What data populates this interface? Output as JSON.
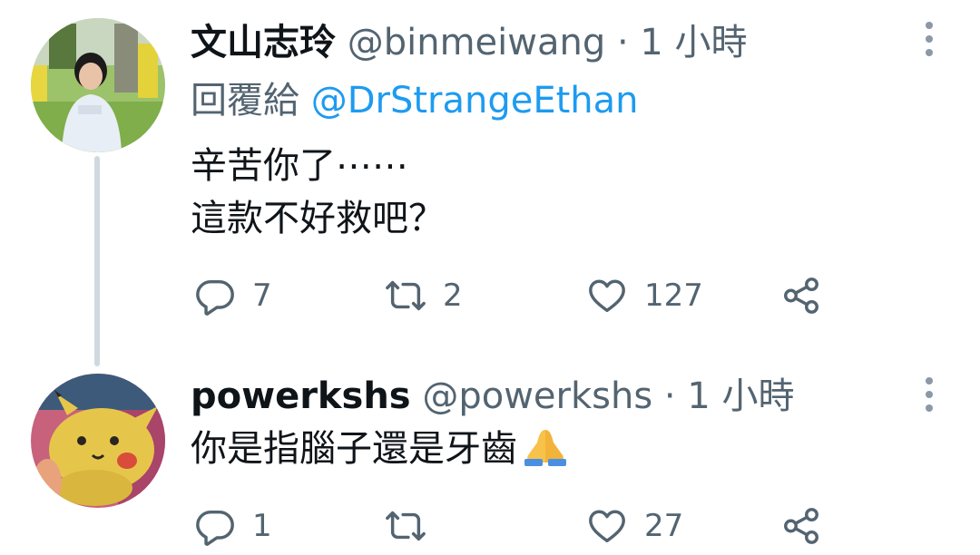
{
  "tweets": [
    {
      "display_name": "文山志玲",
      "handle": "@binmeiwang",
      "separator": "·",
      "time": "1 小時",
      "reply_prefix": "回覆給",
      "reply_to": "@DrStrangeEthan",
      "body_lines": [
        "辛苦你了⋯⋯",
        "這款不好救吧？"
      ],
      "replies": "7",
      "retweets": "2",
      "likes": "127",
      "avatar": "woman-in-white-shirt-photo"
    },
    {
      "display_name": "powerkshs",
      "handle": "@powerkshs",
      "separator": "·",
      "time": "1 小時",
      "body_lines": [
        "你是指腦子還是牙齒"
      ],
      "body_emoji": "folded-hands-emoji",
      "replies": "1",
      "retweets": "",
      "likes": "27",
      "avatar": "yellow-plush-toy-photo"
    }
  ],
  "colors": {
    "text": "#0f1419",
    "secondary": "#536471",
    "link": "#1d9bf0",
    "thread_line": "#cfd9de"
  },
  "icons": [
    "reply-icon",
    "retweet-icon",
    "like-icon",
    "share-icon",
    "more-options-icon"
  ]
}
